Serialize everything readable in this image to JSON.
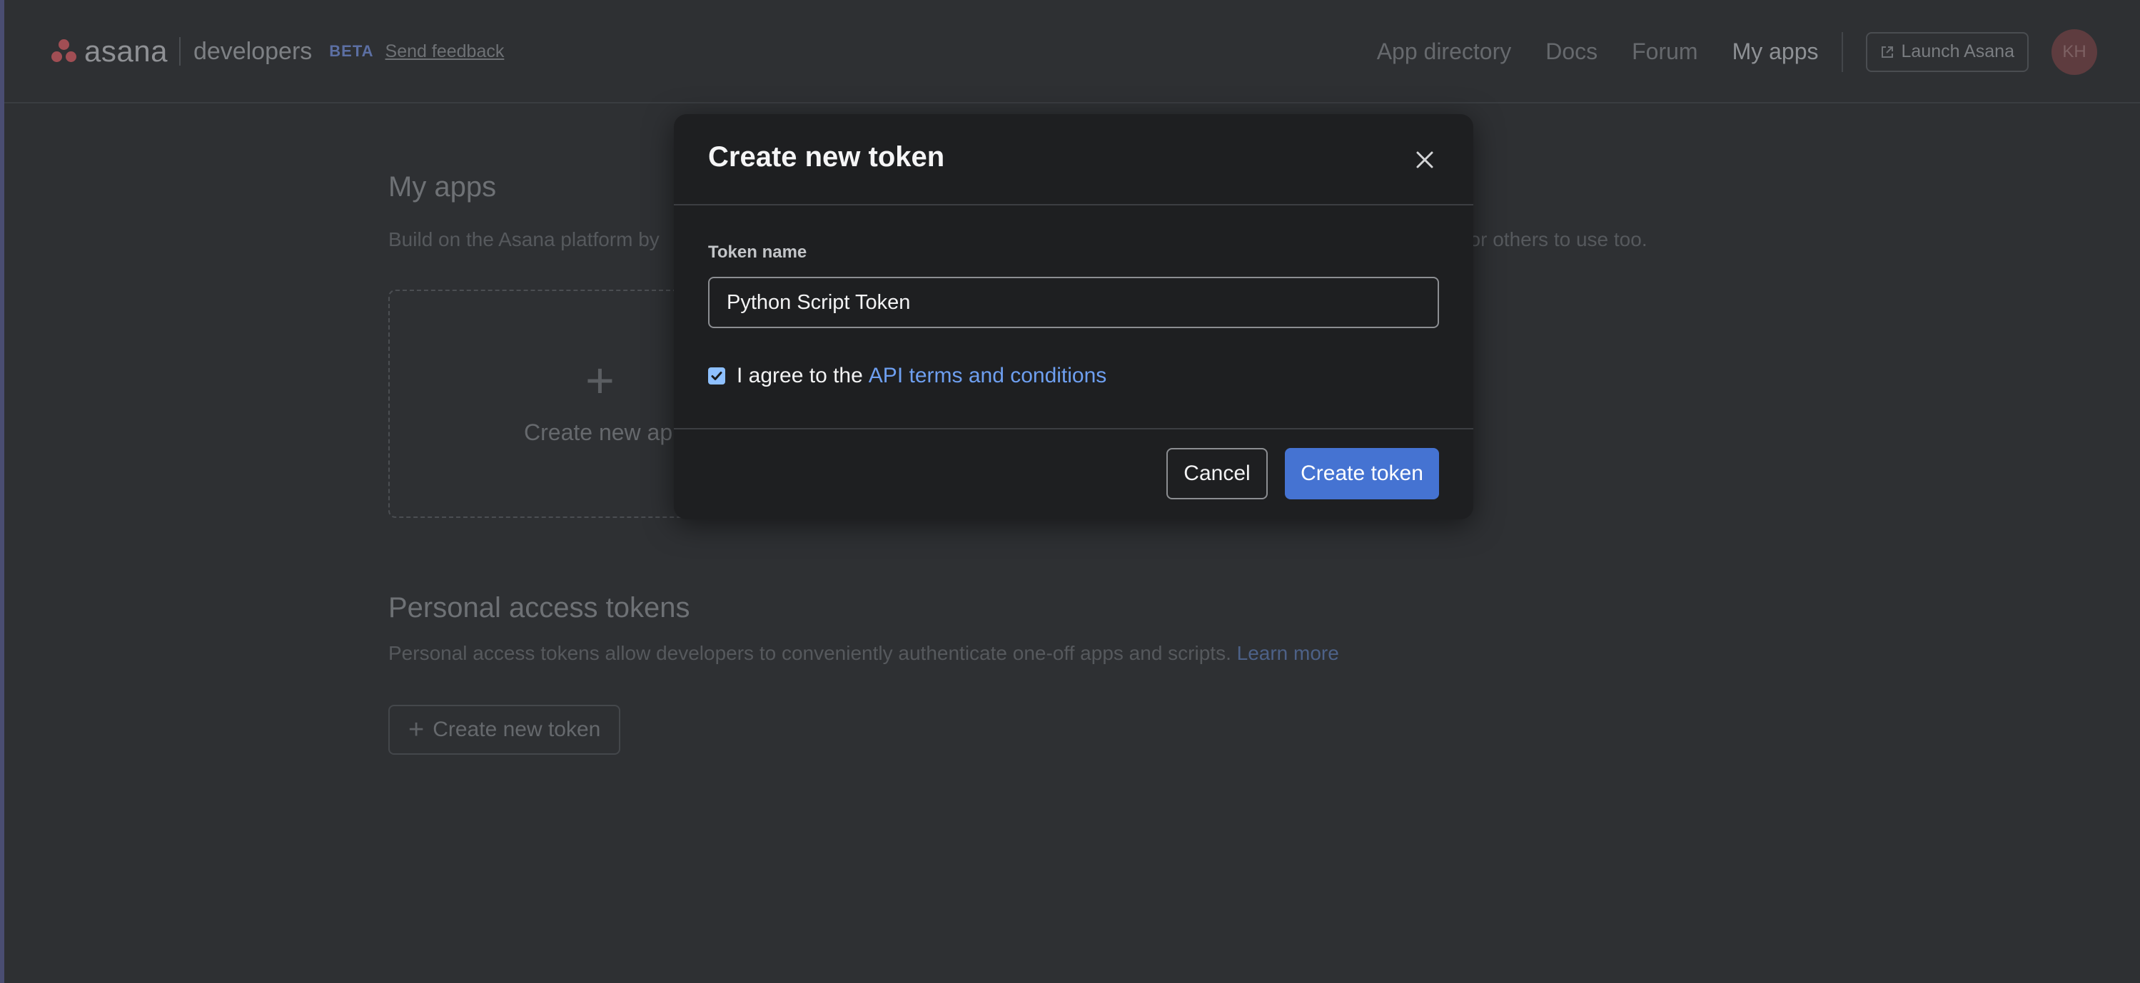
{
  "header": {
    "logo_word": "asana",
    "logo_suffix": "developers",
    "beta_badge": "BETA",
    "feedback_link": "Send feedback",
    "nav": [
      "App directory",
      "Docs",
      "Forum",
      "My apps"
    ],
    "active_nav": "My apps",
    "launch_button": "Launch Asana",
    "avatar_initials": "KH"
  },
  "main": {
    "my_apps_title": "My apps",
    "my_apps_desc_visible_left": "Build on the Asana platform by",
    "my_apps_desc_visible_right": "y for others to use too.",
    "create_app_card_plus": "+",
    "create_app_card_label": "Create new ap",
    "pat_title": "Personal access tokens",
    "pat_desc": "Personal access tokens allow developers to conveniently authenticate one-off apps and scripts.",
    "pat_learn_more": "Learn more",
    "create_token_outline_label": "Create new token"
  },
  "modal": {
    "title": "Create new token",
    "token_name_label": "Token name",
    "token_name_value": "Python Script Token",
    "agree_checked": true,
    "agree_text": "I agree to the",
    "agree_link": "API terms and conditions",
    "cancel_label": "Cancel",
    "create_label": "Create token"
  },
  "colors": {
    "page_bg": "#2e3033",
    "modal_bg": "#1e1f21",
    "accent_blue": "#4573d2",
    "link_blue": "#6e9ff0",
    "logo_red": "#a14e54"
  }
}
